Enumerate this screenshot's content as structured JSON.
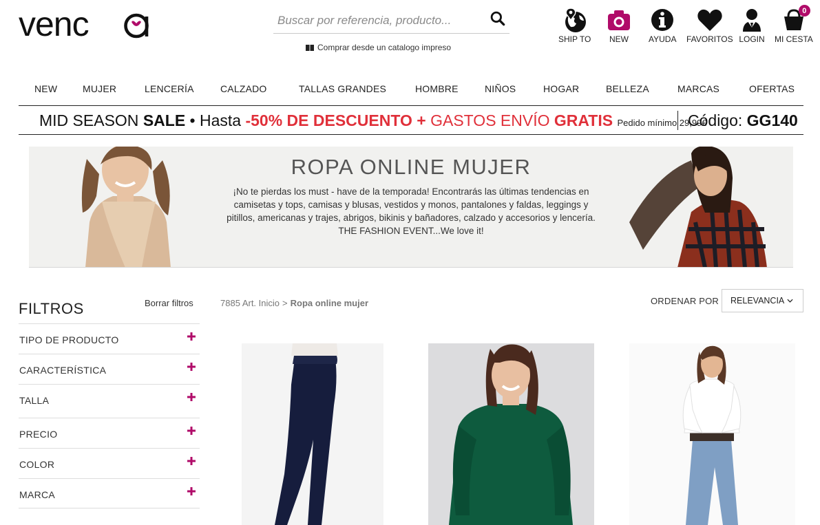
{
  "brand": {
    "logo_text": "venca",
    "accent": "#b00b69"
  },
  "search": {
    "placeholder": "Buscar por referencia, producto..."
  },
  "catalog_link": "Comprar desde un catalogo impreso",
  "top_icons": [
    {
      "label": "SHIP TO",
      "icon": "globe-pin-icon"
    },
    {
      "label": "NEW",
      "icon": "camera-icon"
    },
    {
      "label": "AYUDA",
      "icon": "info-icon"
    },
    {
      "label": "FAVORITOS",
      "icon": "heart-icon"
    },
    {
      "label": "LOGIN",
      "icon": "user-icon"
    },
    {
      "label": "MI CESTA",
      "icon": "basket-icon",
      "badge": "0"
    }
  ],
  "nav": [
    "NEW",
    "MUJER",
    "LENCERÍA",
    "CALZADO",
    "TALLAS GRANDES",
    "HOMBRE",
    "NIÑOS",
    "HOGAR",
    "BELLEZA",
    "MARCAS",
    "OFERTAS"
  ],
  "promo": {
    "part1": "MID SEASON ",
    "part2": "SALE",
    "part3": " • Hasta ",
    "part4": "-50% DE DESCUENTO + ",
    "part5": "GASTOS ENVÍO ",
    "part6": "GRATIS",
    "minimum": "Pedido mínimo 29,99€",
    "code_label": "Código: ",
    "code": "GG140",
    "red_color": "#e0303a"
  },
  "hero": {
    "title": "ROPA ONLINE MUJER",
    "text": "¡No te pierdas los must - have de la temporada! Encontrarás las últimas tendencias en camisetas y tops, camisas y blusas, vestidos y monos, pantalones y faldas, leggings y pitillos, americanas y trajes, abrigos, bikinis y bañadores, calzado y accesorios y lencería. THE FASHION EVENT...We love it!"
  },
  "filters": {
    "title": "FILTROS",
    "clear": "Borrar filtros",
    "items": [
      "TIPO DE PRODUCTO",
      "CARACTERÍSTICA",
      "TALLA",
      "PRECIO",
      "COLOR",
      "MARCA"
    ]
  },
  "listing": {
    "count": "7885 Art.",
    "crumb_home": "Inicio",
    "crumb_sep": ">",
    "crumb_current": "Ropa online mujer",
    "sort_label": "ORDENAR POR",
    "sort_value": "RELEVANCIA"
  },
  "products": [
    {
      "name": "navy-leggings"
    },
    {
      "name": "green-sweater"
    },
    {
      "name": "white-shirt-jeans"
    }
  ]
}
